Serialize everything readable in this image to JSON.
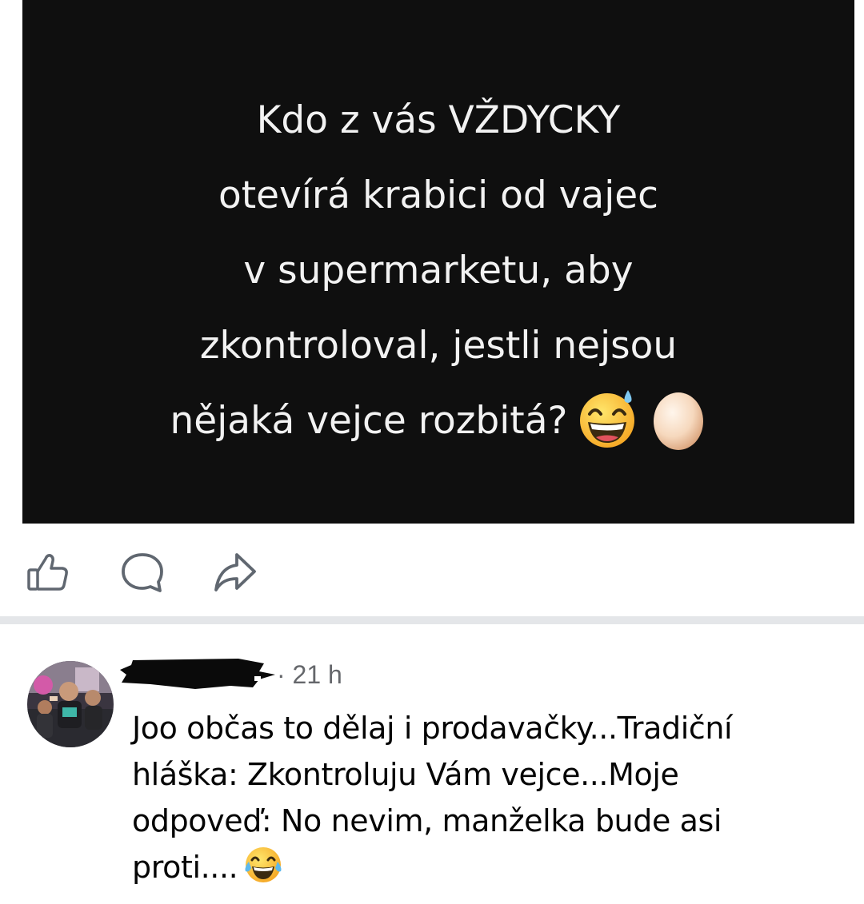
{
  "post": {
    "text_lines": [
      "Kdo z vás VŽDYCKY",
      "otevírá krabici od vajec",
      "v supermarketu, aby",
      "zkontroloval, jestli nejsou",
      "nějaká vejce rozbitá?"
    ],
    "emojis": [
      "grinning-sweat-emoji",
      "egg-emoji"
    ]
  },
  "actions": {
    "like_icon": "thumbs-up-icon",
    "comment_icon": "speech-bubble-icon",
    "share_icon": "share-arrow-icon"
  },
  "comment": {
    "author": "",
    "time": "· 21 h",
    "text_lines": [
      "Joo občas to dělaj i prodavačky...Tradiční",
      "hláška: Zkontroluju Vám vejce...Moje",
      "odpoveď: No nevim, manželka bude asi",
      "proti...."
    ],
    "emoji": "tears-of-joy-emoji"
  },
  "colors": {
    "post_background": "#0f0f0f",
    "post_text": "#f2f2f2",
    "separator": "#e4e6e9",
    "meta_text": "#65676b",
    "comment_text": "#050505"
  }
}
